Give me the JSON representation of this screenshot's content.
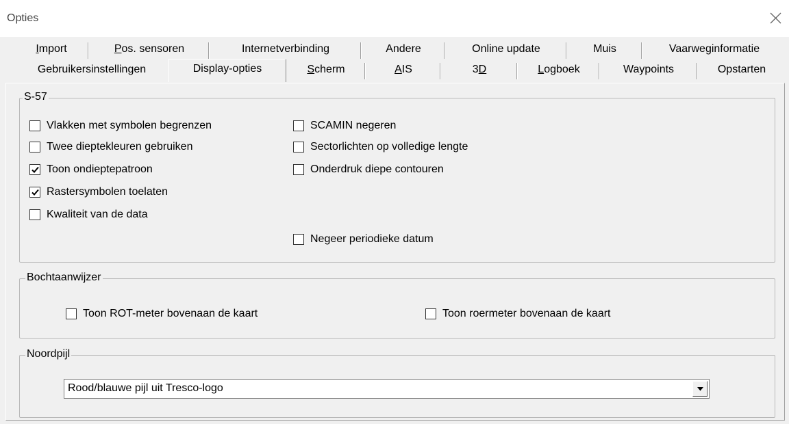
{
  "window": {
    "title": "Opties"
  },
  "tabs_top": [
    {
      "label_pre": "",
      "mnemonic": "I",
      "label_post": "mport"
    },
    {
      "label_pre": "",
      "mnemonic": "P",
      "label_post": "os. sensoren"
    },
    {
      "label": "Internetverbinding"
    },
    {
      "label": "Andere"
    },
    {
      "label": "Online update"
    },
    {
      "label": "Muis"
    },
    {
      "label": "Vaarweginformatie"
    }
  ],
  "tabs_bottom": [
    {
      "label": "Gebruikersinstellingen"
    },
    {
      "label": "Display-opties",
      "active": true
    },
    {
      "label_pre": "",
      "mnemonic": "S",
      "label_post": "cherm"
    },
    {
      "label_pre": "",
      "mnemonic": "A",
      "label_post": "IS"
    },
    {
      "label_pre": "3",
      "mnemonic": "D",
      "label_post": ""
    },
    {
      "label_pre": "",
      "mnemonic": "L",
      "label_post": "ogboek"
    },
    {
      "label": "Waypoints"
    },
    {
      "label": "Opstarten"
    }
  ],
  "s57": {
    "title": "S-57",
    "options": [
      {
        "label": "Vlakken met symbolen begrenzen",
        "checked": false
      },
      {
        "label": "Twee dieptekleuren gebruiken",
        "checked": false
      },
      {
        "label": "Toon ondieptepatroon",
        "checked": true
      },
      {
        "label": "Rastersymbolen toelaten",
        "checked": true
      },
      {
        "label": "Kwaliteit van de data",
        "checked": false
      },
      {
        "label": "SCAMIN negeren",
        "checked": false
      },
      {
        "label": "Sectorlichten op volledige lengte",
        "checked": false
      },
      {
        "label": "Onderdruk diepe contouren",
        "checked": false
      },
      {
        "label": "Negeer periodieke datum",
        "checked": false
      }
    ]
  },
  "bochtaanwijzer": {
    "title": "Bochtaanwijzer",
    "options": [
      {
        "label": "Toon ROT-meter bovenaan de kaart",
        "checked": false
      },
      {
        "label": "Toon roermeter bovenaan de kaart",
        "checked": false
      }
    ]
  },
  "noordpijl": {
    "title": "Noordpijl",
    "selected": "Rood/blauwe pijl uit Tresco-logo"
  },
  "icons": {
    "close": "close-icon",
    "check": "checkmark-icon",
    "dropdown": "triangle-down-icon"
  }
}
